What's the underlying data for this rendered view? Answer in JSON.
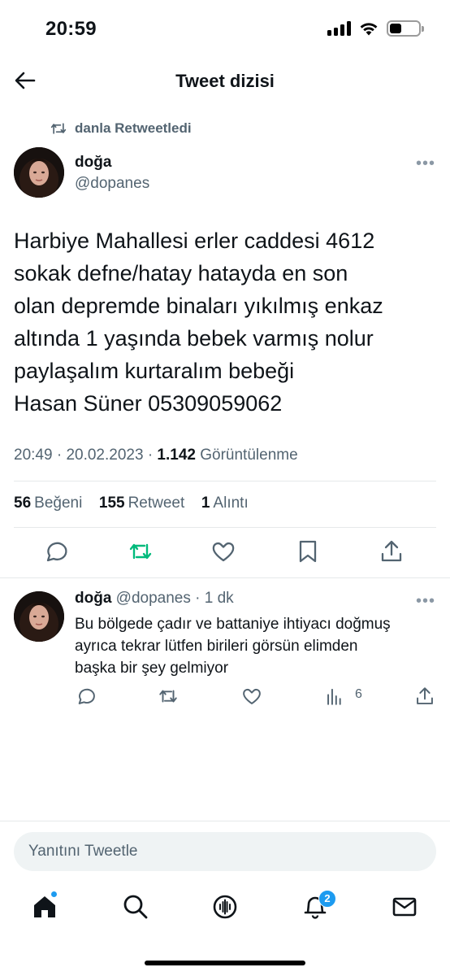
{
  "status_bar": {
    "time": "20:59"
  },
  "header": {
    "title": "Tweet dizisi"
  },
  "retweet_context": {
    "label": "danla Retweetledi"
  },
  "main_tweet": {
    "author_name": "doğa",
    "author_handle": "@dopanes",
    "text_lines": [
      "Harbiye Mahallesi erler caddesi 4612",
      "sokak defne/hatay hatayda en son",
      "olan depremde binaları yıkılmış enkaz",
      "altında 1 yaşında bebek varmış nolur",
      "paylaşalım kurtaralım bebeği",
      "Hasan Süner 05309059062"
    ],
    "time": "20:49",
    "date": "20.02.2023",
    "views_count": "1.142",
    "views_label": "Görüntülenme",
    "likes_count": "56",
    "likes_label": "Beğeni",
    "retweets_count": "155",
    "retweets_label": "Retweet",
    "quotes_count": "1",
    "quotes_label": "Alıntı",
    "retweet_color": "#00ba7c"
  },
  "reply_tweet": {
    "author_name": "doğa",
    "author_handle": "@dopanes",
    "age": "1 dk",
    "text_lines": [
      "Bu bölgede çadır ve battaniye ihtiyacı doğmuş",
      "ayrıca tekrar lütfen birileri görsün elimden",
      "başka bir şey gelmiyor"
    ],
    "views_count": "6"
  },
  "reply_box": {
    "placeholder": "Yanıtını Tweetle"
  },
  "tab_bar": {
    "notifications_badge": "2",
    "accent_color": "#1d9bf0",
    "items": [
      "home-icon",
      "search-icon",
      "spaces-icon",
      "notifications-icon",
      "messages-icon"
    ]
  }
}
